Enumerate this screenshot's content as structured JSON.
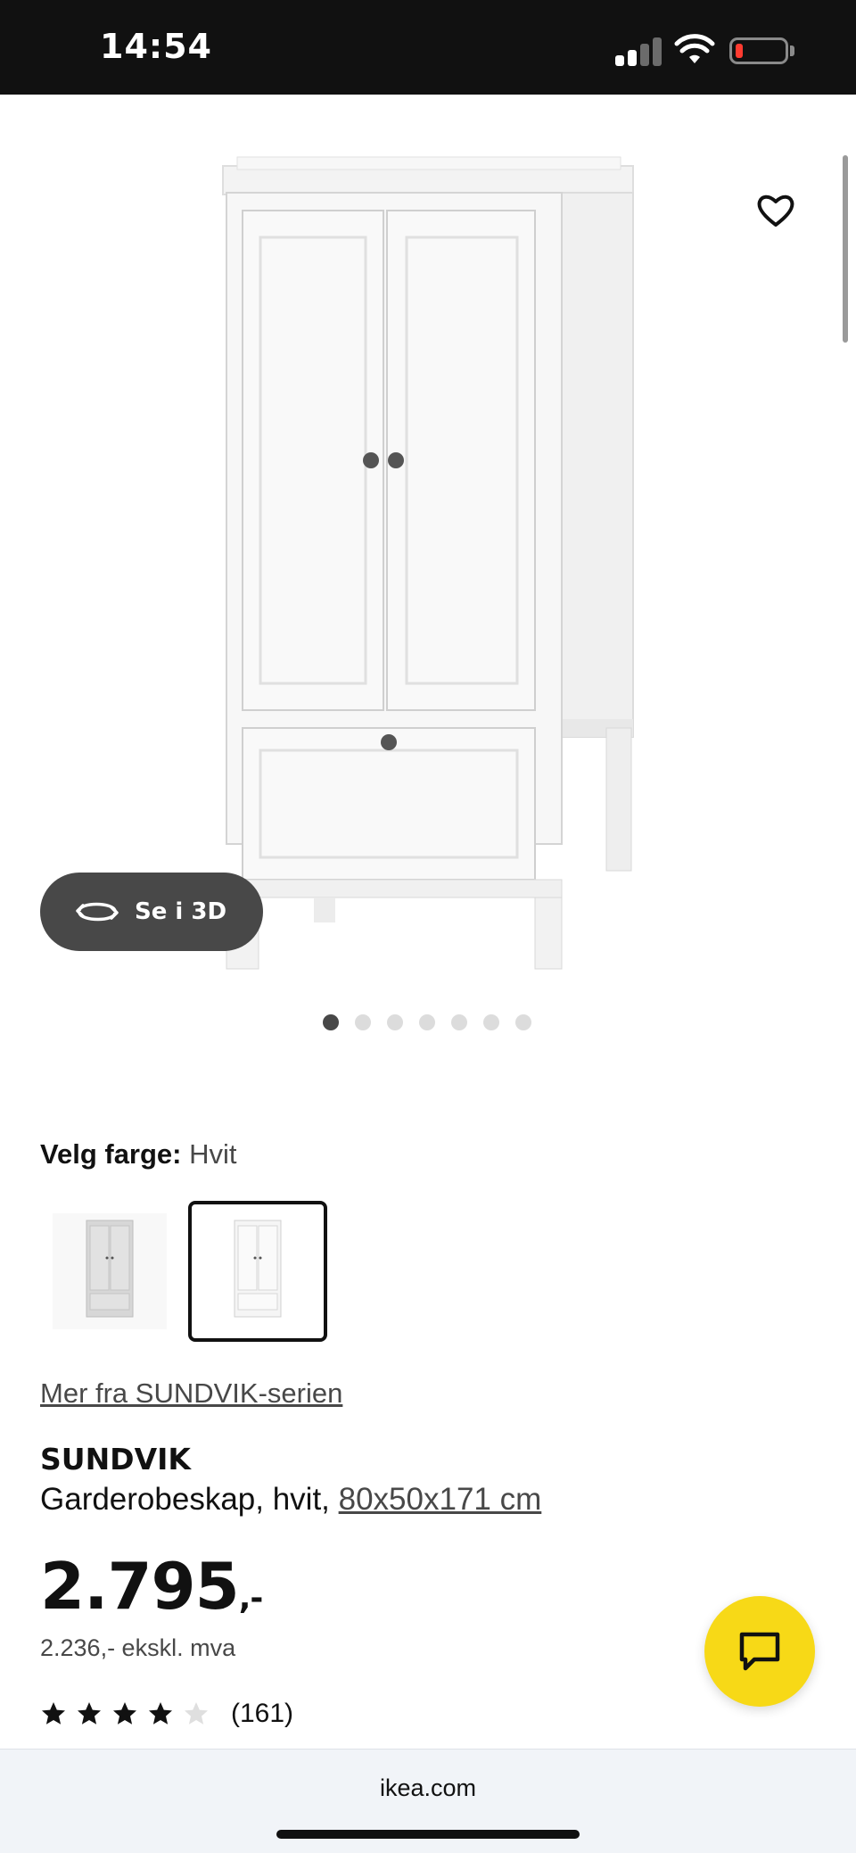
{
  "status_bar": {
    "time": "14:54",
    "battery_level": 0.15
  },
  "product_gallery": {
    "view_3d_label": "Se i 3D",
    "image_count": 7,
    "active_image_index": 0,
    "favorite_icon": "heart-outline-icon"
  },
  "color_picker": {
    "label": "Velg farge:",
    "selected_value": "Hvit",
    "swatches": [
      {
        "name": "gray-variant",
        "selected": false
      },
      {
        "name": "white-variant",
        "selected": true
      }
    ]
  },
  "product": {
    "series_link": "Mer fra SUNDVIK-serien",
    "name": "SUNDVIK",
    "description": "Garderobeskap, hvit, ",
    "dimensions": "80x50x171 cm",
    "price_main": "2.795",
    "price_suffix": ",-",
    "price_ex_vat": "2.236,- ekskl. mva",
    "rating": 4,
    "rating_max": 5,
    "review_count": "(161)"
  },
  "chat": {
    "icon": "chat-bubble-icon",
    "color": "#f7d917"
  },
  "browser": {
    "url": "ikea.com"
  }
}
